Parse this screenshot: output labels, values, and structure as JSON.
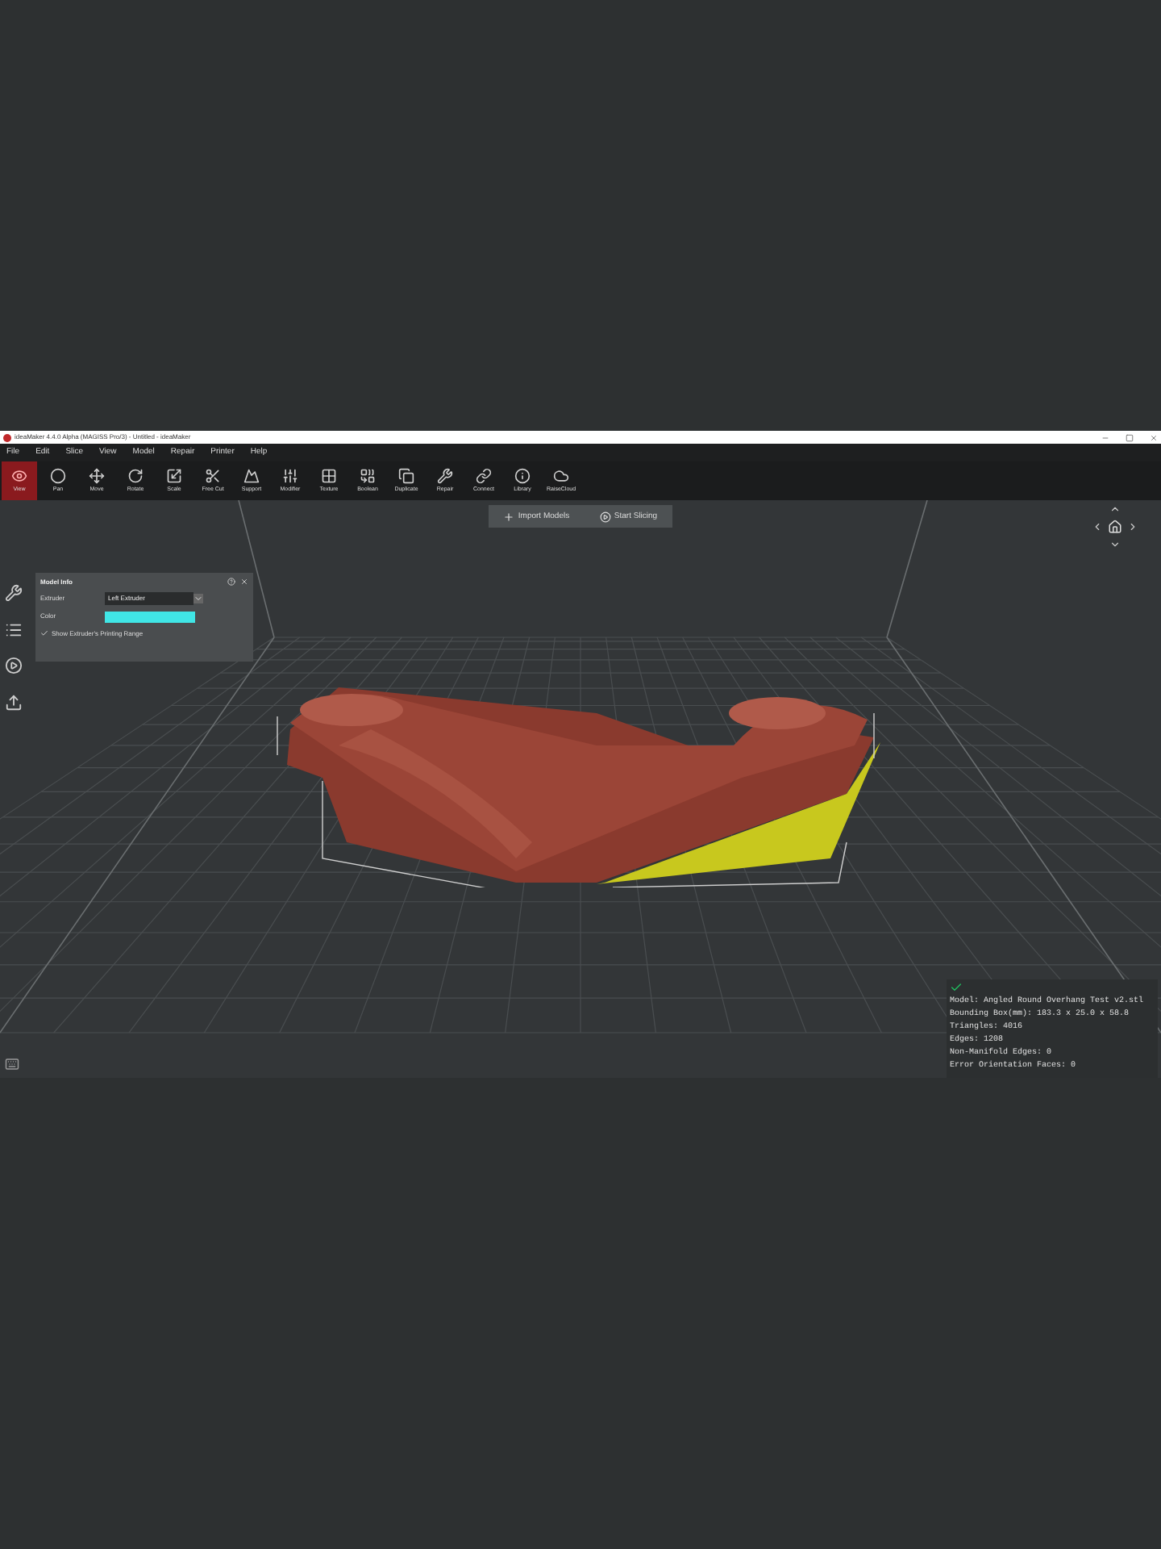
{
  "window": {
    "title": "ideaMaker 4.4.0 Alpha (MAGISS Pro/3) - Untitled - ideaMaker"
  },
  "menu": [
    "File",
    "Edit",
    "Slice",
    "View",
    "Model",
    "Repair",
    "Printer",
    "Help"
  ],
  "toolbar": [
    {
      "label": "View",
      "selected": true
    },
    {
      "label": "Pan",
      "selected": false
    },
    {
      "label": "Move",
      "selected": false
    },
    {
      "label": "Rotate",
      "selected": false
    },
    {
      "label": "Scale",
      "selected": false
    },
    {
      "label": "Free Cut",
      "selected": false
    },
    {
      "label": "Support",
      "selected": false
    },
    {
      "label": "Modifier",
      "selected": false
    },
    {
      "label": "Texture",
      "selected": false
    },
    {
      "label": "Boolean",
      "selected": false
    },
    {
      "label": "Duplicate",
      "selected": false
    },
    {
      "label": "Repair",
      "selected": false
    },
    {
      "label": "Connect",
      "selected": false
    },
    {
      "label": "Library",
      "selected": false
    },
    {
      "label": "RaiseCloud",
      "selected": false
    }
  ],
  "actions": [
    "Import Models",
    "Start Slicing"
  ],
  "model_info": {
    "title": "Model Info",
    "extruder_label": "Extruder",
    "extruder_value": "Left Extruder",
    "color_label": "Color",
    "color": "#40e6e6",
    "show_range": {
      "label": "Show Extruder's Printing Range",
      "checked": true
    }
  },
  "stats": [
    "Model: Angled Round Overhang Test v2.stl",
    "Bounding Box(mm): 183.3 x 25.0 x 58.8",
    "Triangles: 4016",
    "Edges: 1208",
    "Non-Manifold Edges: 0",
    "Error Orientation Faces: 0"
  ]
}
